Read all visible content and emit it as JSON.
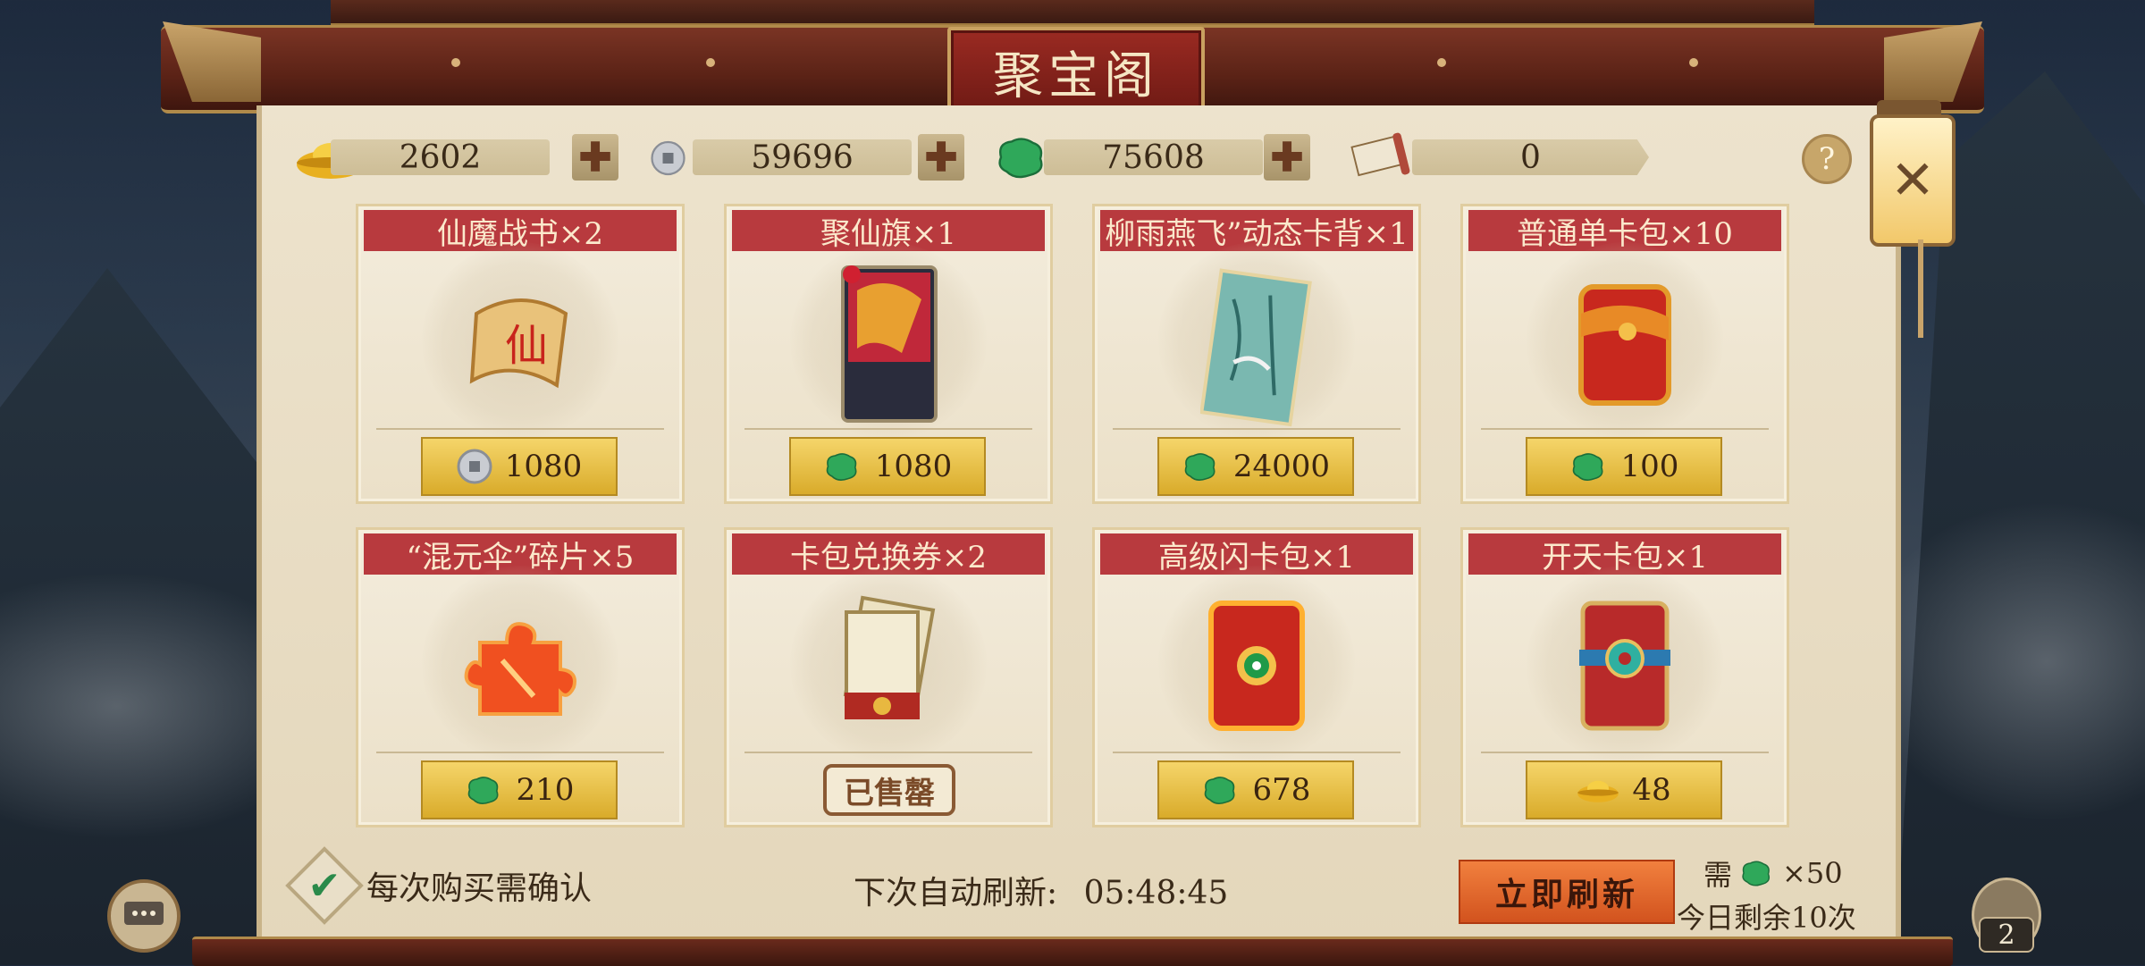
{
  "title": "聚宝阁",
  "currencies": [
    {
      "icon": "gold-ingot-icon",
      "value": "2602"
    },
    {
      "icon": "silver-coin-icon",
      "value": "59696"
    },
    {
      "icon": "jade-icon",
      "value": "75608"
    },
    {
      "icon": "scroll-ticket-icon",
      "value": "0"
    }
  ],
  "help_label": "?",
  "items": [
    {
      "title": "仙魔战书×2",
      "item_icon": "immortal-scroll-icon",
      "currency_icon": "silver-coin-icon",
      "price": "1080",
      "sold": false
    },
    {
      "title": "聚仙旗×1",
      "item_icon": "flag-card-icon",
      "currency_icon": "jade-icon",
      "price": "1080",
      "sold": false
    },
    {
      "title": "柳雨燕飞”动态卡背×1",
      "item_icon": "card-back-icon",
      "currency_icon": "jade-icon",
      "price": "24000",
      "sold": false
    },
    {
      "title": "普通单卡包×10",
      "item_icon": "card-pack-icon",
      "currency_icon": "jade-icon",
      "price": "100",
      "sold": false
    },
    {
      "title": "“混元伞”碎片×5",
      "item_icon": "puzzle-fragment-icon",
      "currency_icon": "jade-icon",
      "price": "210",
      "sold": false
    },
    {
      "title": "卡包兑换券×2",
      "item_icon": "pack-voucher-icon",
      "currency_icon": "",
      "price": "",
      "sold": true,
      "sold_label": "已售罄"
    },
    {
      "title": "高级闪卡包×1",
      "item_icon": "flash-card-pack-icon",
      "currency_icon": "jade-icon",
      "price": "678",
      "sold": false
    },
    {
      "title": "开天卡包×1",
      "item_icon": "kaitian-card-pack-icon",
      "currency_icon": "gold-ingot-icon",
      "price": "48",
      "sold": false
    }
  ],
  "footer": {
    "confirm_label": "每次购买需确认",
    "refresh_label": "下次自动刷新:",
    "refresh_time": "05:48:45",
    "refresh_button": "立即刷新",
    "need_label": "需",
    "need_cost": "×50",
    "remaining": "今日剩余10次"
  },
  "bag_count": "2",
  "colors": {
    "title_red": "#b83a3e",
    "gold": "#d9ab2a",
    "jade": "#2fa85a",
    "panel": "#ede3cd"
  }
}
